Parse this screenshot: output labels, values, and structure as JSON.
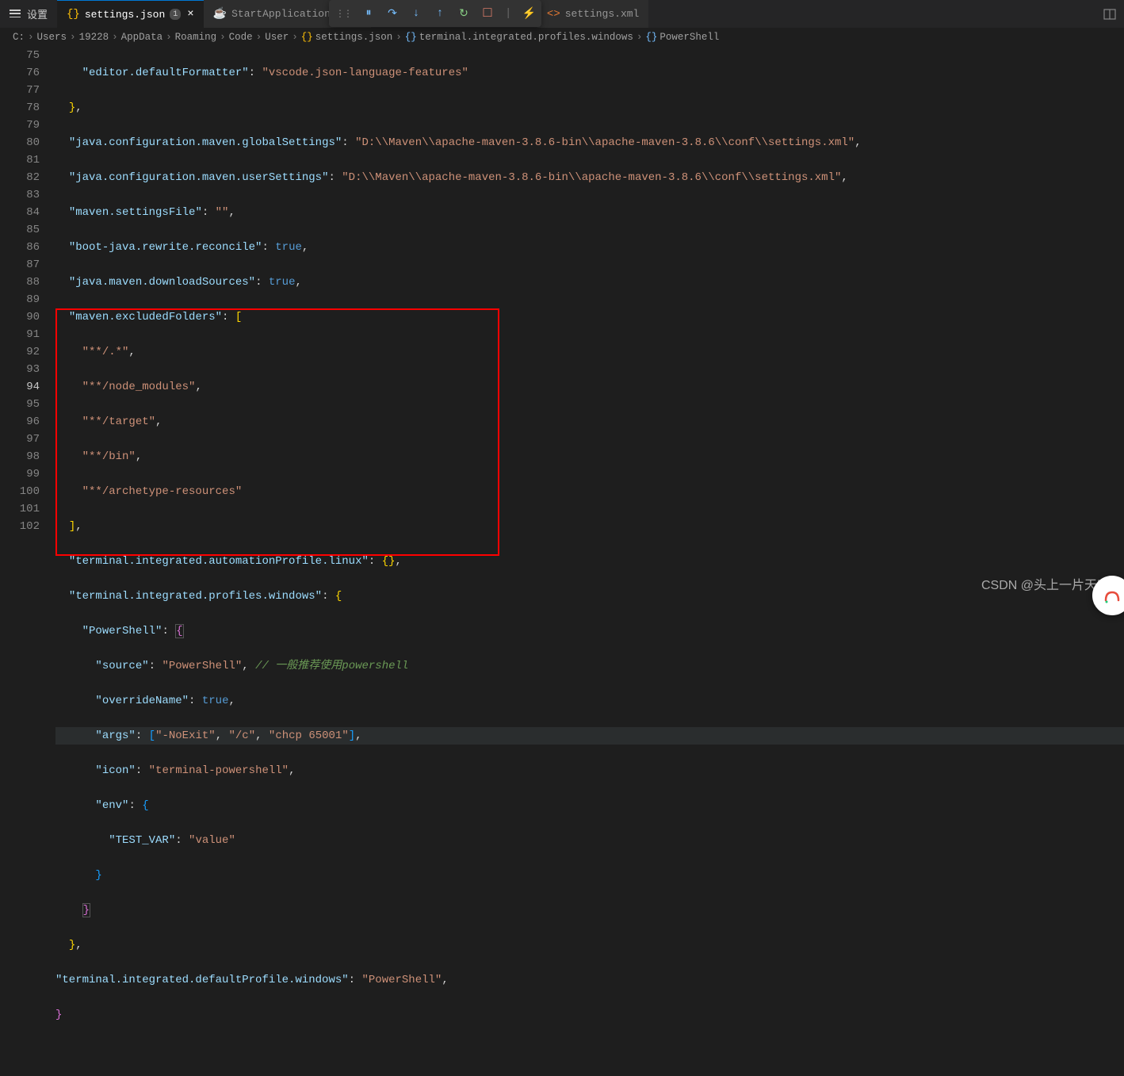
{
  "tabs": {
    "settingsLink": "设置",
    "active": {
      "icon": "{}",
      "label": "settings.json",
      "badge": "1"
    },
    "t2": {
      "icon": "☕",
      "label": "StartApplication.java"
    },
    "t3": {
      "icon": "<>",
      "label": "settings.xml"
    }
  },
  "debug": {
    "pause": "⏸",
    "stepOver": "↷",
    "stepInto": "↓",
    "stepOut": "↑",
    "restart": "↻",
    "stop": "□",
    "hot": "⚡"
  },
  "breadcrumbs": {
    "c1": "C:",
    "c2": "Users",
    "c3": "19228",
    "c4": "AppData",
    "c5": "Roaming",
    "c6": "Code",
    "c7": "User",
    "c8": "settings.json",
    "c9": "terminal.integrated.profiles.windows",
    "c10": "PowerShell"
  },
  "lines": {
    "start": 75,
    "end": 102,
    "l75k": "\"editor.defaultFormatter\"",
    "l75v": "\"vscode.json-language-features\"",
    "l77k": "\"java.configuration.maven.globalSettings\"",
    "l77v": "\"D:\\\\Maven\\\\apache-maven-3.8.6-bin\\\\apache-maven-3.8.6\\\\conf\\\\settings.xml\"",
    "l78k": "\"java.configuration.maven.userSettings\"",
    "l78v": "\"D:\\\\Maven\\\\apache-maven-3.8.6-bin\\\\apache-maven-3.8.6\\\\conf\\\\settings.xml\"",
    "l79k": "\"maven.settingsFile\"",
    "l79v": "\"\"",
    "l80k": "\"boot-java.rewrite.reconcile\"",
    "l80v": "true",
    "l81k": "\"java.maven.downloadSources\"",
    "l81v": "true",
    "l82k": "\"maven.excludedFolders\"",
    "l83v": "\"**/.*\"",
    "l84v": "\"**/node_modules\"",
    "l85v": "\"**/target\"",
    "l86v": "\"**/bin\"",
    "l87v": "\"**/archetype-resources\"",
    "l89k": "\"terminal.integrated.automationProfile.linux\"",
    "l90k": "\"terminal.integrated.profiles.windows\"",
    "l91k": "\"PowerShell\"",
    "l92k": "\"source\"",
    "l92v": "\"PowerShell\"",
    "l92c": "// 一般推荐使用powershell",
    "l93k": "\"overrideName\"",
    "l93v": "true",
    "l94k": "\"args\"",
    "l94a1": "\"-NoExit\"",
    "l94a2": "\"/c\"",
    "l94a3": "\"chcp 65001\"",
    "l95k": "\"icon\"",
    "l95v": "\"terminal-powershell\"",
    "l96k": "\"env\"",
    "l97k": "\"TEST_VAR\"",
    "l97v": "\"value\"",
    "l101k": "\"terminal.integrated.defaultProfile.windows\"",
    "l101v": "\"PowerShell\""
  },
  "watermark": "CSDN @头上一片天空"
}
